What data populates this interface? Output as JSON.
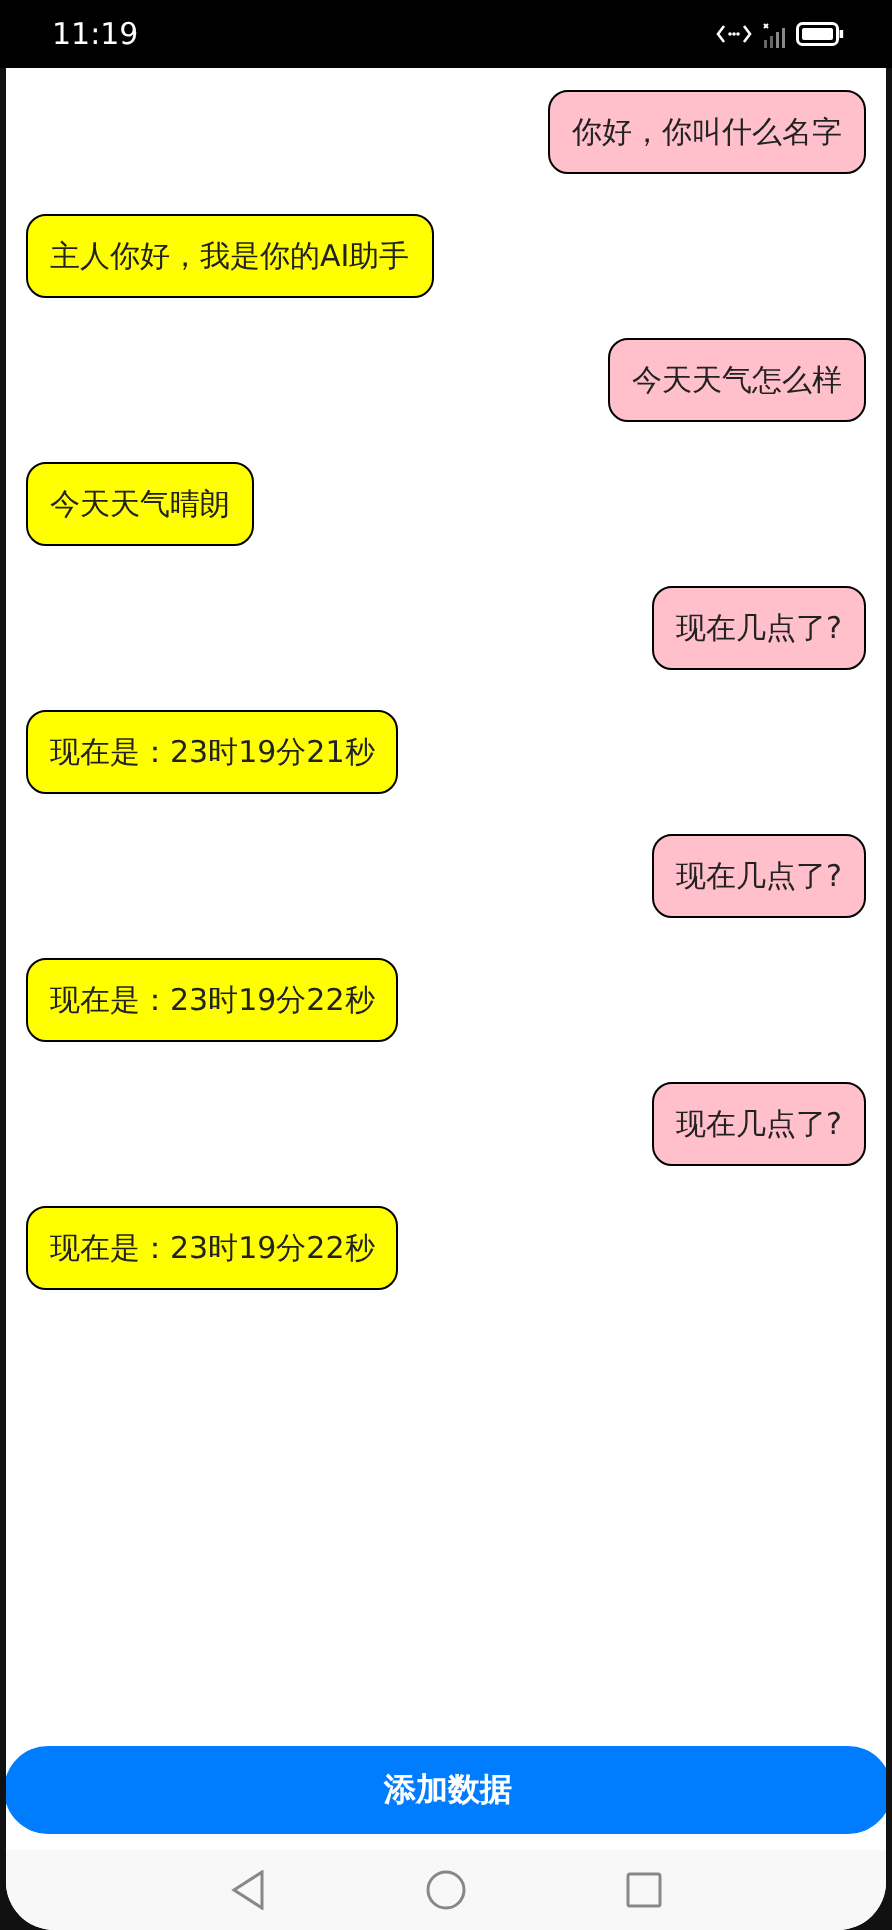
{
  "status_bar": {
    "time": "11:19"
  },
  "messages": [
    {
      "kind": "user",
      "text": "你好，你叫什么名字"
    },
    {
      "kind": "bot",
      "text": "主人你好，我是你的AI助手"
    },
    {
      "kind": "user",
      "text": "今天天气怎么样"
    },
    {
      "kind": "bot",
      "text": "今天天气晴朗"
    },
    {
      "kind": "user",
      "text": "现在几点了?"
    },
    {
      "kind": "bot",
      "text": "现在是：23时19分21秒"
    },
    {
      "kind": "user",
      "text": "现在几点了?"
    },
    {
      "kind": "bot",
      "text": "现在是：23时19分22秒"
    },
    {
      "kind": "user",
      "text": "现在几点了?"
    },
    {
      "kind": "bot",
      "text": "现在是：23时19分22秒"
    }
  ],
  "add_button": {
    "label": "添加数据"
  }
}
